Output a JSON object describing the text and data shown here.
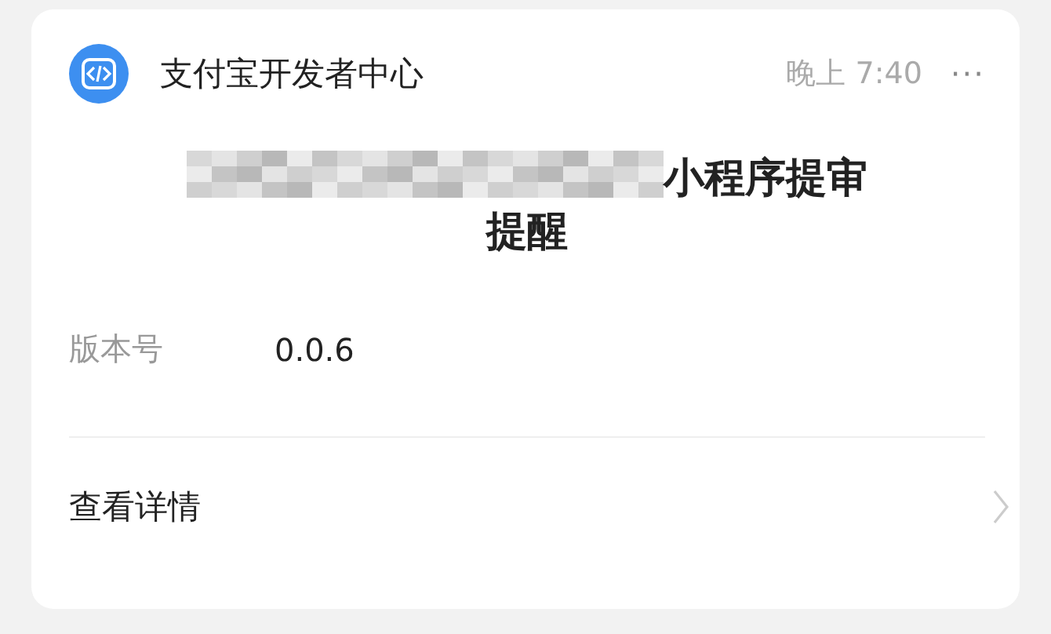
{
  "header": {
    "title": "支付宝开发者中心",
    "time": "晚上 7:40",
    "more": "···"
  },
  "notice": {
    "title": "小程序提审提醒",
    "redacted_prefix": true
  },
  "fields": [
    {
      "label": "版本号",
      "value": "0.0.6"
    }
  ],
  "link": {
    "label": "查看详情"
  }
}
